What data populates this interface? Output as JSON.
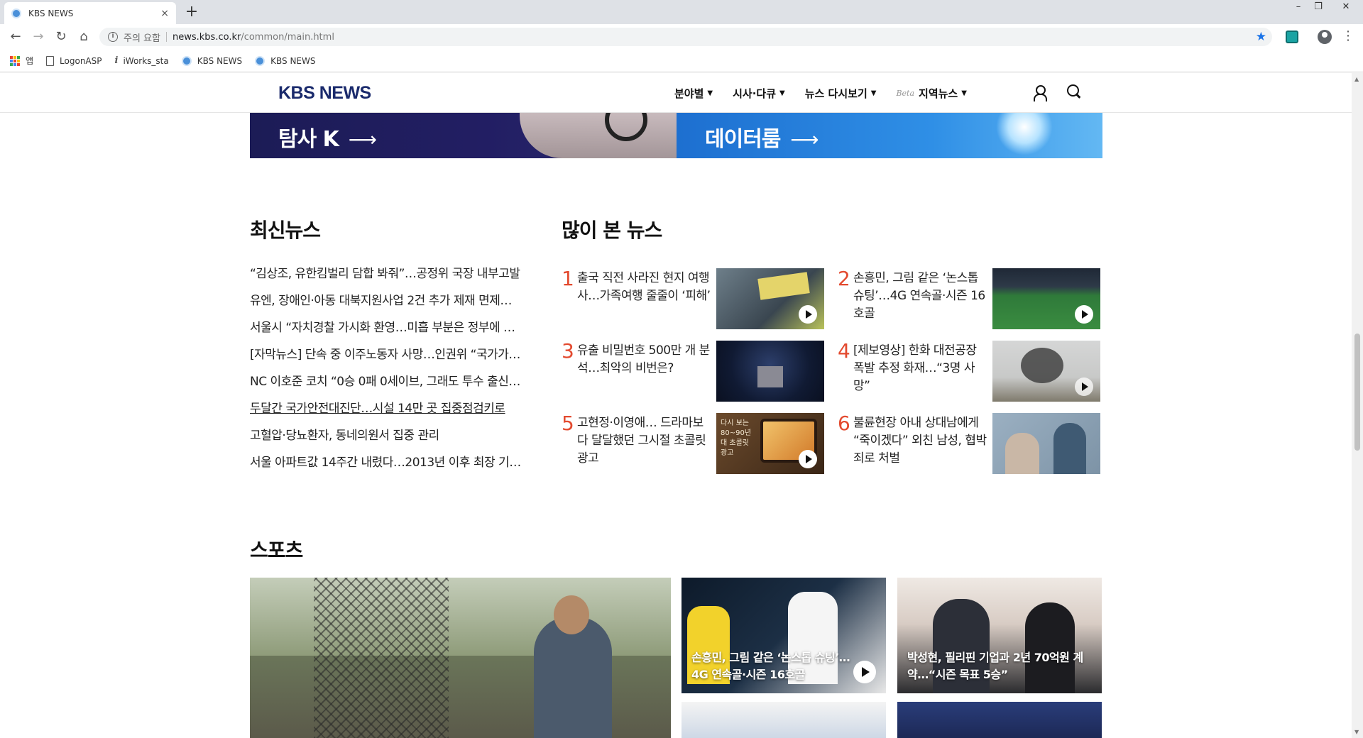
{
  "browser": {
    "tab_title": "KBS NEWS",
    "tab_close": "×",
    "new_tab": "+",
    "security_text": "주의 요함",
    "url_host": "news.kbs.co.kr",
    "url_path": "/common/main.html",
    "bookmarks": [
      {
        "label": "앱",
        "icon": "apps-grid-icon"
      },
      {
        "label": "LogonASP",
        "icon": "document-icon"
      },
      {
        "label": "iWorks_sta",
        "icon": "iworks-icon"
      },
      {
        "label": "KBS NEWS",
        "icon": "globe-icon"
      },
      {
        "label": "KBS NEWS",
        "icon": "globe-icon"
      }
    ]
  },
  "header": {
    "logo": "KBS NEWS",
    "nav": [
      {
        "label": "분야별"
      },
      {
        "label": "시사·다큐"
      },
      {
        "label": "뉴스 다시보기"
      },
      {
        "label": "지역뉴스",
        "badge": "Beta"
      }
    ]
  },
  "banners": {
    "left": "탐사 K",
    "right": "데이터룸",
    "arrow": "⟶"
  },
  "latest": {
    "title": "최신뉴스",
    "items": [
      "“김상조, 유한킴벌리 담합 봐줘”…공정위 국장 내부고발",
      "유엔, 장애인·아동 대북지원사업 2건 추가 제재 면제…",
      "서울시 “자치경찰 가시화 환영…미흡 부분은 정부에 …",
      "[자막뉴스] 단속 중 이주노동자 사망…인권위 “국가가…",
      "NC 이호준 코치 “0승 0패 0세이브, 그래도 투수 출신…",
      "두달간 국가안전대진단…시설 14만 곳 집중점검키로",
      "고혈압·당뇨환자, 동네의원서 집중 관리",
      "서울 아파트값 14주간 내렸다…2013년 이후 최장 기…"
    ]
  },
  "popular": {
    "title": "많이 본 뉴스",
    "items": [
      {
        "rank": "1",
        "text": "출국 직전 사라진 현지 여행사…가족여행 줄줄이 ‘피해’",
        "video": true
      },
      {
        "rank": "2",
        "text": "손흥민, 그림 같은 ‘논스톱 슈팅’…4G 연속골·시즌 16호골",
        "video": true
      },
      {
        "rank": "3",
        "text": "유출 비밀번호 500만 개 분석…최악의 비번은?",
        "video": false
      },
      {
        "rank": "4",
        "text": "[제보영상] 한화 대전공장 폭발 추정 화재…“3명 사망”",
        "video": true
      },
      {
        "rank": "5",
        "text": "고현정·이영애… 드라마보다 달달했던 그시절 초콜릿 광고",
        "video": true,
        "thumb_text": "다시 보는 80~90년대 초콜릿 광고"
      },
      {
        "rank": "6",
        "text": "불륜현장 아내 상대남에게 “죽이겠다” 외친 남성, 협박죄로 처벌",
        "video": false
      }
    ]
  },
  "sports": {
    "title": "스포츠",
    "cards": [
      {
        "caption": "손흥민, 그림 같은 ‘논스톱 슈팅’…4G 연속골·시즌 16호골",
        "video": true
      },
      {
        "caption": "박성현, 필리핀 기업과 2년 70억원 계약…“시즌 목표 5승”",
        "video": false
      }
    ]
  }
}
